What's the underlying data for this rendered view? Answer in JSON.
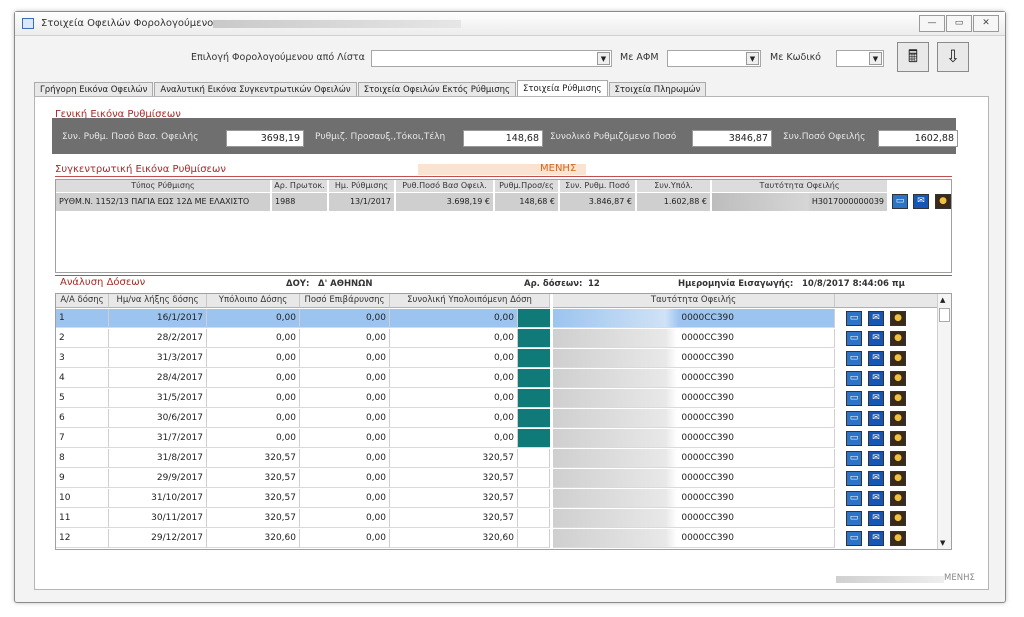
{
  "window": {
    "title": "Στοιχεία Οφειλών Φορολογούμενου",
    "controls": [
      "—",
      "▭",
      "✕"
    ]
  },
  "toolbar": {
    "select_taxpayer_label": "Επιλογή Φορολογούμενου από Λίστα",
    "afm_label": "Με ΑΦΜ",
    "code_label": "Με Κωδικό"
  },
  "tabs": [
    {
      "label": "Γρήγορη Εικόνα Οφειλών"
    },
    {
      "label": "Αναλυτική Εικόνα Συγκεντρωτικών Οφειλών"
    },
    {
      "label": "Στοιχεία Οφειλών Εκτός Ρύθμισης"
    },
    {
      "label": "Στοιχεία Ρύθμισης"
    },
    {
      "label": "Στοιχεία Πληρωμών"
    }
  ],
  "overview": {
    "title": "Γενική Εικόνα Ρυθμίσεων",
    "base_label": "Συν. Ρυθμ. Ποσό Βασ. Οφειλής",
    "base_value": "3698,19",
    "surcharges_label": "Ρυθμιζ. Προσαυξ.,Τόκοι,Τέλη",
    "surcharges_value": "148,68",
    "total_label": "Συνολικό Ρυθμιζόμενο Ποσό",
    "total_value": "3846,87",
    "debt_label": "Συν.Ποσό Οφειλής",
    "debt_value": "1602,88"
  },
  "summary": {
    "title": "Συγκεντρωτική Εικόνα Ρυθμίσεων",
    "highlight_text": "ΜΕΝΗΣ",
    "headers": [
      "Τύπος Ρύθμισης",
      "Αρ. Πρωτοκ.",
      "Ημ. Ρύθμισης",
      "Ρυθ.Ποσό Βασ Οφειλ.",
      "Ρυθμ.Προσ/ες",
      "Συν. Ρυθμ. Ποσό",
      "Συν.Υπόλ.",
      "Ταυτότητα Οφειλής"
    ],
    "row": {
      "type": "ΡΥΘΜ.Ν. 1152/13 ΠΑΓΙΑ ΕΩΣ 12Δ ΜΕ ΕΛΑΧΙΣΤΟ",
      "protocol": "1988",
      "date": "13/1/2017",
      "base": "3.698,19 €",
      "surcharges": "148,68 €",
      "total": "3.846,87 €",
      "remaining": "1.602,88 €",
      "identity": "H3017000000039"
    }
  },
  "installments": {
    "title": "Ανάλυση Δόσεων",
    "doy_label": "ΔΟΥ:",
    "doy_value": "Δ' ΑΘΗΝΩΝ",
    "count_label": "Αρ. δόσεων:",
    "count_value": "12",
    "entry_label": "Ημερομηνία Εισαγωγής:",
    "entry_value": "10/8/2017 8:44:06 πμ",
    "headers": [
      "Α/Α δόσης",
      "Ημ/να λήξης δόσης",
      "Υπόλοιπο Δόσης",
      "Ποσό Επιβάρυνσης",
      "Συνολική Υπολοιπόμενη Δόση",
      "Ταυτότητα Οφειλής"
    ],
    "rows": [
      {
        "n": "1",
        "due": "16/1/2017",
        "rem": "0,00",
        "charge": "0,00",
        "total": "0,00",
        "id": "0000CC390",
        "paid": true
      },
      {
        "n": "2",
        "due": "28/2/2017",
        "rem": "0,00",
        "charge": "0,00",
        "total": "0,00",
        "id": "0000CC390",
        "paid": true
      },
      {
        "n": "3",
        "due": "31/3/2017",
        "rem": "0,00",
        "charge": "0,00",
        "total": "0,00",
        "id": "0000CC390",
        "paid": true
      },
      {
        "n": "4",
        "due": "28/4/2017",
        "rem": "0,00",
        "charge": "0,00",
        "total": "0,00",
        "id": "0000CC390",
        "paid": true
      },
      {
        "n": "5",
        "due": "31/5/2017",
        "rem": "0,00",
        "charge": "0,00",
        "total": "0,00",
        "id": "0000CC390",
        "paid": true
      },
      {
        "n": "6",
        "due": "30/6/2017",
        "rem": "0,00",
        "charge": "0,00",
        "total": "0,00",
        "id": "0000CC390",
        "paid": true
      },
      {
        "n": "7",
        "due": "31/7/2017",
        "rem": "0,00",
        "charge": "0,00",
        "total": "0,00",
        "id": "0000CC390",
        "paid": true
      },
      {
        "n": "8",
        "due": "31/8/2017",
        "rem": "320,57",
        "charge": "0,00",
        "total": "320,57",
        "id": "0000CC390",
        "paid": false
      },
      {
        "n": "9",
        "due": "29/9/2017",
        "rem": "320,57",
        "charge": "0,00",
        "total": "320,57",
        "id": "0000CC390",
        "paid": false
      },
      {
        "n": "10",
        "due": "31/10/2017",
        "rem": "320,57",
        "charge": "0,00",
        "total": "320,57",
        "id": "0000CC390",
        "paid": false
      },
      {
        "n": "11",
        "due": "30/11/2017",
        "rem": "320,57",
        "charge": "0,00",
        "total": "320,57",
        "id": "0000CC390",
        "paid": false
      },
      {
        "n": "12",
        "due": "29/12/2017",
        "rem": "320,60",
        "charge": "0,00",
        "total": "320,60",
        "id": "0000CC390",
        "paid": false
      }
    ]
  },
  "footer": {
    "text": "ΜΕΝΗΣ"
  },
  "colors": {
    "accent": "#a52a2a",
    "selection": "#9cc4ee",
    "paid_marker": "#0f7a78",
    "summary_bar": "#6f6f6f"
  }
}
